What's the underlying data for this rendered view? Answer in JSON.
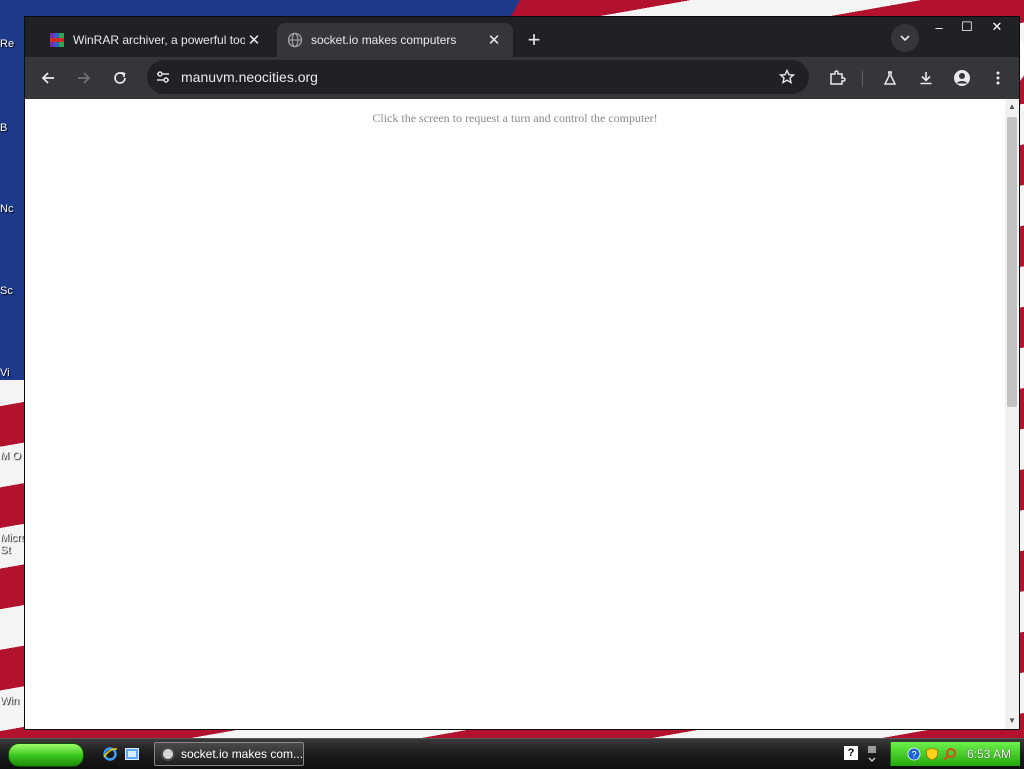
{
  "desktop": {
    "icon_labels": [
      "Re",
      "B",
      "Nc",
      "Sc",
      "Vi",
      "M O",
      "Micro St",
      "Win"
    ]
  },
  "browser": {
    "tabs": [
      {
        "title": "WinRAR archiver, a powerful tool t",
        "icon": "winrar-icon",
        "active": false
      },
      {
        "title": "socket.io makes computers",
        "icon": "globe-icon",
        "active": true
      }
    ],
    "close_glyph": "✕",
    "new_tab_glyph": "+",
    "window_controls": {
      "minimize": "–",
      "maximize": "☐",
      "close": "✕"
    },
    "url": "manuvm.neocities.org"
  },
  "page": {
    "message": "Click the screen to request a turn and control the computer!"
  },
  "taskbar": {
    "task_label": "socket.io makes com...",
    "help_glyph": "?",
    "clock": "6:53 AM"
  },
  "colors": {
    "accent_dark": "#35363a",
    "tray_green": "#23a80c"
  }
}
